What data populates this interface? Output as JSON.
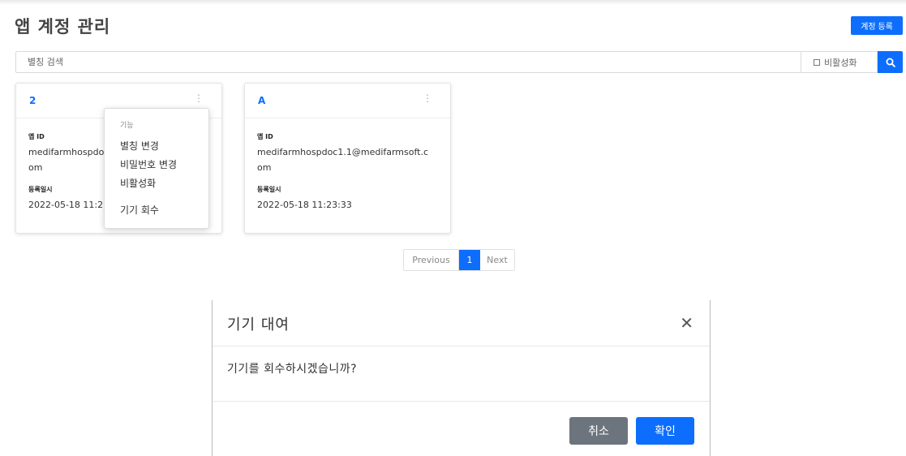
{
  "page": {
    "title": "앱 계정 관리",
    "register_label": "계정 등록"
  },
  "search": {
    "placeholder": "별칭 검색",
    "inactive_label": "비활성화",
    "search_icon": "search-icon"
  },
  "cards": [
    {
      "title": "2",
      "menu_icon": "vertical-dots-icon",
      "app_id_label": "앱 ID",
      "app_id": "medifarmhospdoc",
      "app_id_wrap": "om",
      "registered_label": "등록일시",
      "registered_at": "2022-05-18 11:2"
    },
    {
      "title": "A",
      "menu_icon": "vertical-dots-icon",
      "app_id_label": "앱 ID",
      "app_id": "medifarmhospdoc1.1@medifarmsoft.c",
      "app_id_wrap": "om",
      "registered_label": "등록일시",
      "registered_at": "2022-05-18 11:23:33"
    }
  ],
  "dropdown": {
    "header": "기능",
    "items": [
      "별칭 변경",
      "비밀번호 변경",
      "비활성화",
      "기기 회수"
    ]
  },
  "pagination": {
    "previous": "Previous",
    "current": "1",
    "next": "Next"
  },
  "modal": {
    "title": "기기 대여",
    "close_icon": "close-icon",
    "message": "기기를 회수하시겠습니까?",
    "cancel_label": "취소",
    "confirm_label": "확인"
  },
  "colors": {
    "primary": "#0d6efd",
    "secondary": "#6c757d"
  }
}
